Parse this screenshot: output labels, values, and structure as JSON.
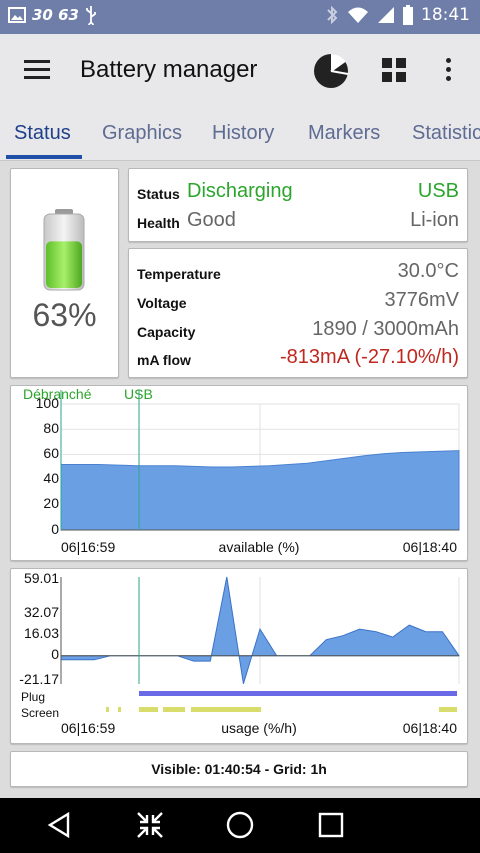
{
  "status_bar": {
    "left_text": "30 63",
    "time": "18:41"
  },
  "app_bar": {
    "title": "Battery manager"
  },
  "tabs": [
    {
      "label": "Status"
    },
    {
      "label": "Graphics"
    },
    {
      "label": "History"
    },
    {
      "label": "Markers"
    },
    {
      "label": "Statistics"
    }
  ],
  "battery": {
    "percent": "63%",
    "level": 0.63
  },
  "status_card": {
    "status_label": "Status",
    "status_value": "Discharging",
    "status_source": "USB",
    "health_label": "Health",
    "health_value": "Good",
    "health_type": "Li-ion"
  },
  "details_card": {
    "temperature_label": "Temperature",
    "temperature_value": "30.0°C",
    "voltage_label": "Voltage",
    "voltage_value": "3776mV",
    "capacity_label": "Capacity",
    "capacity_value": "1890 / 3000mAh",
    "maflow_label": "mA flow",
    "maflow_value": "-813mA (-27.10%/h)"
  },
  "chart_data": [
    {
      "type": "area",
      "markers": [
        "Débranché",
        "USB"
      ],
      "y_ticks": [
        "100",
        "80",
        "60",
        "40",
        "20",
        "0"
      ],
      "ylim": [
        0,
        100
      ],
      "x_start": "06|16:59",
      "x_end": "06|18:40",
      "xlabel": "available (%)",
      "values": [
        52,
        52,
        52,
        51.5,
        51,
        51,
        51,
        50.5,
        50,
        50,
        50.5,
        51,
        52,
        53,
        55,
        57,
        59,
        60.5,
        61.5,
        62,
        62.5,
        63
      ]
    },
    {
      "type": "area",
      "y_ticks": [
        "59.01",
        "32.07",
        "16.03",
        "0",
        "-21.17"
      ],
      "ylim": [
        -21.17,
        59.01
      ],
      "x_start": "06|16:59",
      "x_end": "06|18:40",
      "xlabel": "usage (%/h)",
      "rows": [
        "Plug",
        "Screen"
      ],
      "values": [
        -3,
        -3,
        -3,
        0,
        0,
        0,
        0,
        0,
        -4,
        -4,
        59,
        -21,
        20,
        0,
        0,
        0,
        12,
        15,
        20,
        18,
        14,
        23,
        18,
        18,
        0
      ]
    }
  ],
  "footer": {
    "visible_text": "Visible: 01:40:54 - Grid: 1h"
  },
  "colors": {
    "accent": "#1e50a8",
    "green": "#2ca52c",
    "red": "#c0281f",
    "chart_fill": "#6b9fe3"
  }
}
